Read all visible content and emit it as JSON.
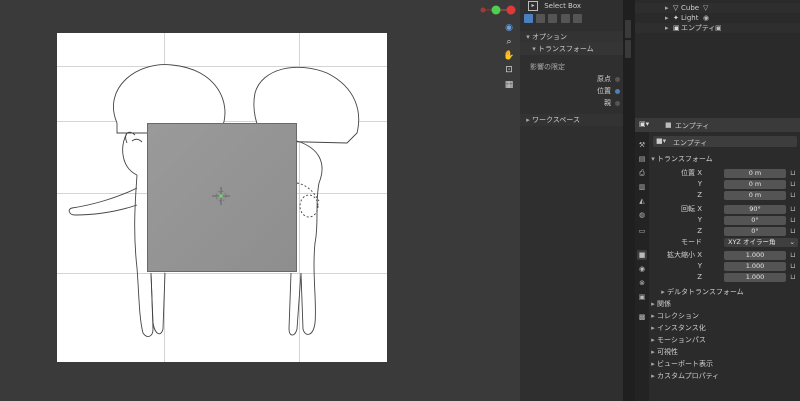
{
  "toolpanel": {
    "tool_name": "Select Box",
    "options_header": "オプション",
    "transform_sub": "トランスフォーム",
    "affect_only_label": "影響の限定",
    "origins_label": "原点",
    "locations_label": "位置",
    "parents_label": "親",
    "workspace_header": "ワークスペース"
  },
  "outliner": {
    "items": [
      {
        "name": "Cube"
      },
      {
        "name": "Light"
      },
      {
        "name": "エンプティ"
      }
    ]
  },
  "properties": {
    "header_object": "エンプティ",
    "object_name": "エンプティ",
    "transform_header": "トランスフォーム",
    "location_label": "位置 X",
    "rotation_label": "回転 X",
    "scale_label": "拡大縮小 X",
    "y_label": "Y",
    "z_label": "Z",
    "mode_label": "モード",
    "mode_value": "XYZ オイラー角",
    "location": [
      "0 m",
      "0 m",
      "0 m"
    ],
    "rotation": [
      "90°",
      "0°",
      "0°"
    ],
    "scale": [
      "1.000",
      "1.000",
      "1.000"
    ],
    "delta_transform": "デルタトランスフォーム",
    "sections": [
      "関係",
      "コレクション",
      "インスタンス化",
      "モーションパス",
      "可視性",
      "ビューポート表示",
      "カスタムプロパティ"
    ]
  },
  "colors": {
    "accent_blue": "#4a7fc0",
    "gizmo_red": "#e0393a",
    "gizmo_green": "#4fcf4f"
  }
}
